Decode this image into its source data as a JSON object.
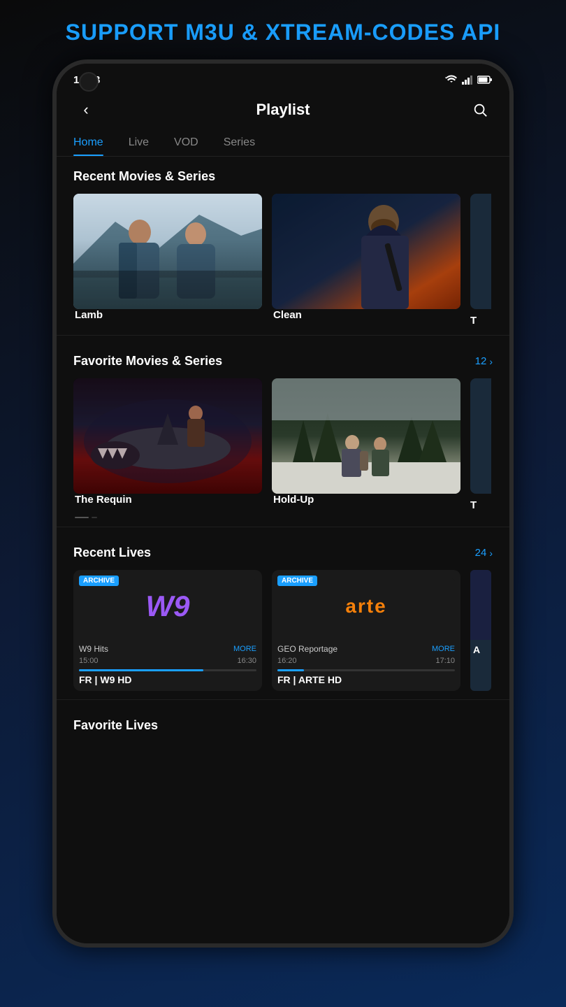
{
  "page": {
    "header_text": "SUPPORT M3U & XTREAM-CODES API",
    "header_color": "#1a9fff"
  },
  "status_bar": {
    "time": "16:23",
    "icons": [
      "wifi",
      "signal",
      "battery"
    ]
  },
  "app_header": {
    "title": "Playlist",
    "back_label": "‹",
    "search_label": "search"
  },
  "tabs": [
    {
      "label": "Home",
      "active": true
    },
    {
      "label": "Live",
      "active": false
    },
    {
      "label": "VOD",
      "active": false
    },
    {
      "label": "Series",
      "active": false
    }
  ],
  "sections": {
    "recent_movies": {
      "title": "Recent Movies & Series",
      "movies": [
        {
          "id": "lamb",
          "title": "Lamb",
          "thumb_type": "lamb"
        },
        {
          "id": "clean",
          "title": "Clean",
          "thumb_type": "clean"
        },
        {
          "id": "partial",
          "title": "T",
          "thumb_type": "partial"
        }
      ]
    },
    "favorite_movies": {
      "title": "Favorite Movies & Series",
      "count": "12",
      "movies": [
        {
          "id": "requin",
          "title": "The Requin",
          "thumb_type": "requin"
        },
        {
          "id": "holdup",
          "title": "Hold-Up",
          "thumb_type": "holdup"
        },
        {
          "id": "partial2",
          "title": "T",
          "thumb_type": "partial"
        }
      ]
    },
    "recent_lives": {
      "title": "Recent Lives",
      "count": "24",
      "channels": [
        {
          "id": "w9",
          "badge": "ARCHIVE",
          "logo": "W9",
          "logo_type": "w9",
          "program_name": "W9 Hits",
          "more": "MORE",
          "time_start": "15:00",
          "time_end": "16:30",
          "progress": 70,
          "channel_name": "FR | W9 HD"
        },
        {
          "id": "arte",
          "badge": "ARCHIVE",
          "logo": "arte",
          "logo_type": "arte",
          "program_name": "GEO Reportage",
          "more": "MORE",
          "time_start": "16:20",
          "time_end": "17:10",
          "progress": 15,
          "channel_name": "FR | ARTE HD"
        },
        {
          "id": "partial_live",
          "channel_name": "A",
          "partial": true
        }
      ]
    },
    "favorite_lives": {
      "title": "Favorite Lives"
    }
  }
}
